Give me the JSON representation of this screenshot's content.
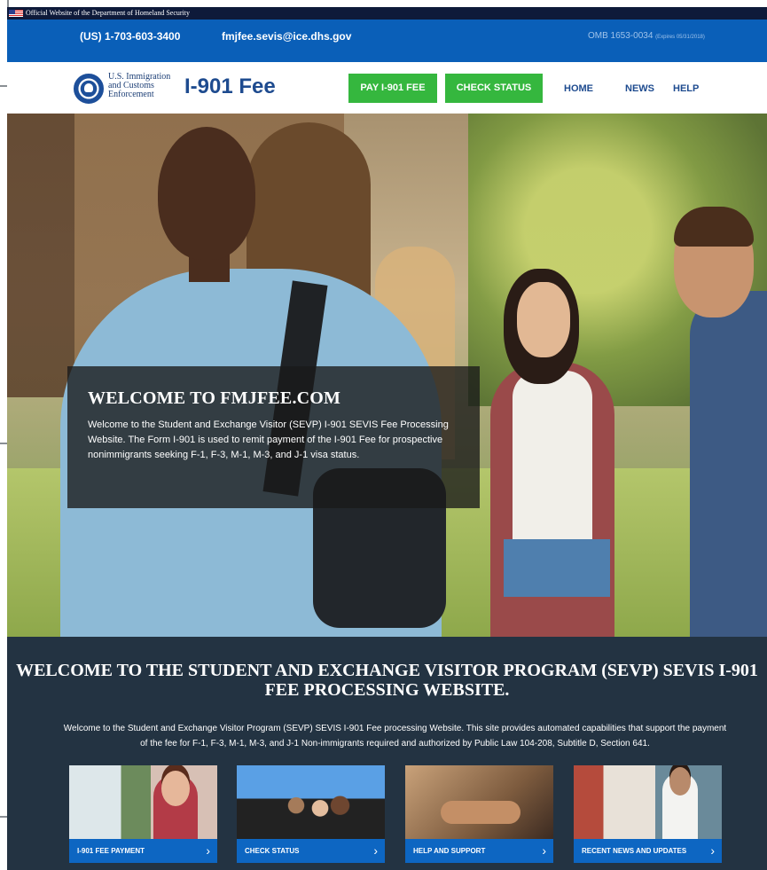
{
  "official_banner": {
    "text": "Official Website of the Department of Homeland Security"
  },
  "contact_bar": {
    "phone": "(US) 1-703-603-3400",
    "email": "fmjfee.sevis@ice.dhs.gov",
    "omb": "OMB 1653-0034",
    "omb_expires": "(Expires 05/31/2018)"
  },
  "header": {
    "agency_lines": [
      "U.S. Immigration",
      "and Customs",
      "Enforcement"
    ],
    "site_title": "I-901 Fee",
    "pay_button": "PAY I-901 FEE",
    "status_button": "CHECK STATUS",
    "nav": [
      "HOME",
      "NEWS",
      "HELP"
    ]
  },
  "hero": {
    "title": "WELCOME TO FMJFEE.COM",
    "text": "Welcome to the Student and Exchange Visitor (SEVP) I-901 SEVIS Fee Processing Website. The Form I-901 is used to remit payment of the I-901 Fee for prospective nonimmigrants seeking F-1, F-3, M-1, M-3, and J-1 visa status."
  },
  "program": {
    "title": "WELCOME TO THE STUDENT AND EXCHANGE VISITOR PROGRAM (SEVP) SEVIS I-901 FEE PROCESSING WEBSITE.",
    "text": "Welcome to the Student and Exchange Visitor Program (SEVP) SEVIS I-901 Fee processing Website. This site provides automated capabilities that support the payment of the fee for F-1, F-3, M-1, M-3, and J-1 Non-immigrants required and authorized by Public Law 104-208, Subtitle D, Section 641."
  },
  "cards": [
    {
      "label": "I-901 FEE PAYMENT",
      "chevron": "›"
    },
    {
      "label": "CHECK STATUS",
      "chevron": "›"
    },
    {
      "label": "HELP AND SUPPORT",
      "chevron": "›"
    },
    {
      "label": "RECENT NEWS AND UPDATES",
      "chevron": "›"
    }
  ],
  "colors": {
    "contact_bar": "#0a5fb8",
    "green_button": "#35b73e",
    "nav_text": "#1e4b8f",
    "dark_section": "#233342",
    "card_bar": "#0d66c2"
  }
}
